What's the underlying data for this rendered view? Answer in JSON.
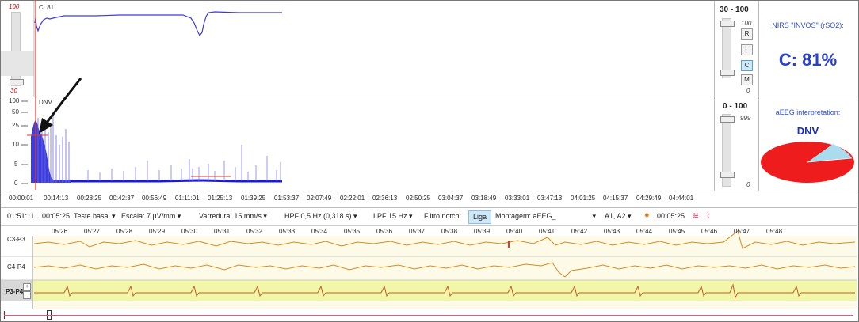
{
  "nirs_plot": {
    "scale_top": "100",
    "scale_bottom": "30",
    "channel_label": "C: 81"
  },
  "aeeg_plot": {
    "scale_labels": [
      "100",
      "50",
      "25",
      "10",
      "5",
      "0"
    ],
    "marker_label": "DNV"
  },
  "controls": {
    "nirs_range": "30 - 100",
    "nirs_max": "100",
    "nirs_min": "0",
    "nirs_buttons": [
      "R",
      "L",
      "C",
      "M"
    ],
    "nirs_active_button": "C",
    "aeeg_range": "0 - 100",
    "aeeg_max": "999",
    "aeeg_min": "0"
  },
  "info": {
    "nirs_title": "NIRS \"INVOS\" (rSO2):",
    "nirs_value": "C: 81%",
    "aeeg_title": "aEEG interpretation:",
    "aeeg_result": "DNV"
  },
  "time_axis": [
    "00:00:01",
    "00:14:13",
    "00:28:25",
    "00:42:37",
    "00:56:49",
    "01:11:01",
    "01:25:13",
    "01:39:25",
    "01:53:37",
    "02:07:49",
    "02:22:01",
    "02:36:13",
    "02:50:25",
    "03:04:37",
    "03:18:49",
    "03:33:01",
    "03:47:13",
    "04:01:25",
    "04:15:37",
    "04:29:49",
    "04:44:01"
  ],
  "toolbar": {
    "time": "01:51:11",
    "elapsed": "00:05:25",
    "mode": "Teste basal",
    "scale": "Escala:  7 µV/mm",
    "sweep": "Varredura:  15 mm/s",
    "hpf": "HPF  0,5 Hz (0,318 s)",
    "lpf": "LPF  15 Hz",
    "notch_label": "Filtro notch:",
    "notch_btn": "Liga",
    "montage": "Montagem:  aEEG_",
    "reference": "A1, A2",
    "timer": "00:05:25"
  },
  "eeg": {
    "channels": [
      "C3-P3",
      "C4-P4",
      "P3-P4"
    ],
    "seconds": [
      "05:26",
      "05:27",
      "05:28",
      "05:29",
      "05:30",
      "05:31",
      "05:32",
      "05:33",
      "05:34",
      "05:35",
      "05:36",
      "05:37",
      "05:38",
      "05:39",
      "05:40",
      "05:41",
      "05:42",
      "05:43",
      "05:44",
      "05:45",
      "05:46",
      "05:47",
      "05:48"
    ]
  },
  "colors": {
    "nirs_line": "#3a3ae0",
    "aeeg_band": "#1a1acf",
    "eeg_trace": "#d88c1e",
    "ecg_trace": "#c85a28",
    "cursor": "#e03a2a",
    "pie_main": "#ee1c1c",
    "pie_slice": "#a8dcee"
  }
}
